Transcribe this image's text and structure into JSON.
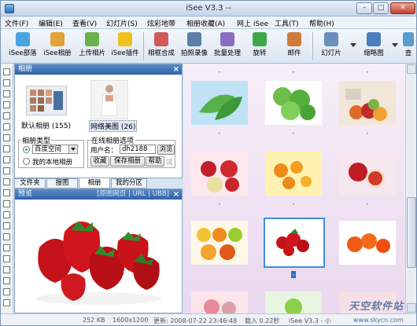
{
  "window": {
    "title": "iSee V3.3 --",
    "controls": {
      "minimize": "–",
      "maximize": "□",
      "close": "✕"
    }
  },
  "menu": [
    "文件(F)",
    "编辑(E)",
    "查看(V)",
    "幻灯片(S)",
    "炫彩地带",
    "相册收藏(A)",
    "网上 iSee",
    "工具(T)",
    "帮助(H)"
  ],
  "toolbar": {
    "buttons": [
      {
        "label": "iSee部落",
        "icon": "people-icon",
        "color": "#4aa3df"
      },
      {
        "label": "iSee相册",
        "icon": "album-icon",
        "color": "#e2a33a"
      },
      {
        "label": "上传相片",
        "icon": "upload-icon",
        "color": "#6ab04c"
      },
      {
        "label": "iSee插件",
        "icon": "plugin-icon",
        "color": "#f0c020"
      },
      {
        "label": "相框合成",
        "icon": "frame-icon",
        "color": "#d05a5a"
      },
      {
        "label": "拍照录像",
        "icon": "camera-icon",
        "color": "#5b7fa8"
      },
      {
        "label": "批量处理",
        "icon": "batch-icon",
        "color": "#8a6fc1"
      },
      {
        "label": "旋转",
        "icon": "rotate-icon",
        "color": "#3ca84a"
      },
      {
        "label": "邮件",
        "icon": "mail-icon",
        "color": "#cf7c3a"
      },
      {
        "label": "幻灯片",
        "icon": "slideshow-icon",
        "color": "#6a8fbd"
      },
      {
        "label": "缩略图",
        "icon": "thumbnail-icon",
        "color": "#4a7fc0"
      },
      {
        "label": "查",
        "icon": "view-icon",
        "color": "#5a9bd0"
      }
    ]
  },
  "album_panel": {
    "title": "相册",
    "albums": [
      {
        "label": "默认相册 (155)"
      },
      {
        "label": "网络美图 (26)"
      }
    ],
    "album_type": {
      "title": "相册类型",
      "options": [
        {
          "label": "百度空间",
          "selected": true
        },
        {
          "label": "我的本地相册",
          "selected": false
        }
      ]
    },
    "online": {
      "title": "在线相册选项",
      "user_label": "用户名：",
      "user_value": "dh2188",
      "browse": "浏览",
      "collect": "收藏",
      "save": "保存相册",
      "help": "帮助",
      "test": "试"
    },
    "tabs": [
      "文件夹",
      "搜图",
      "相册",
      "我的分区"
    ],
    "active_tab": "相册"
  },
  "preview_panel": {
    "title": "预览",
    "links": "[原图网页 | URL | UBB]"
  },
  "grid": {
    "captions": [
      "-",
      "-",
      "-",
      "-",
      "-",
      "-",
      "-",
      "-",
      "-",
      "-",
      "-",
      "-"
    ],
    "selected_index": 7
  },
  "status": {
    "size": "252 KB",
    "dims": "1600x1200",
    "updated": "更新: 2008-07-22 23:46:48",
    "load": "载入 0.22秒",
    "app": "iSee V3.3 - 小"
  },
  "watermark": {
    "main": "天空软件站",
    "sub": "www.skycn.com"
  }
}
